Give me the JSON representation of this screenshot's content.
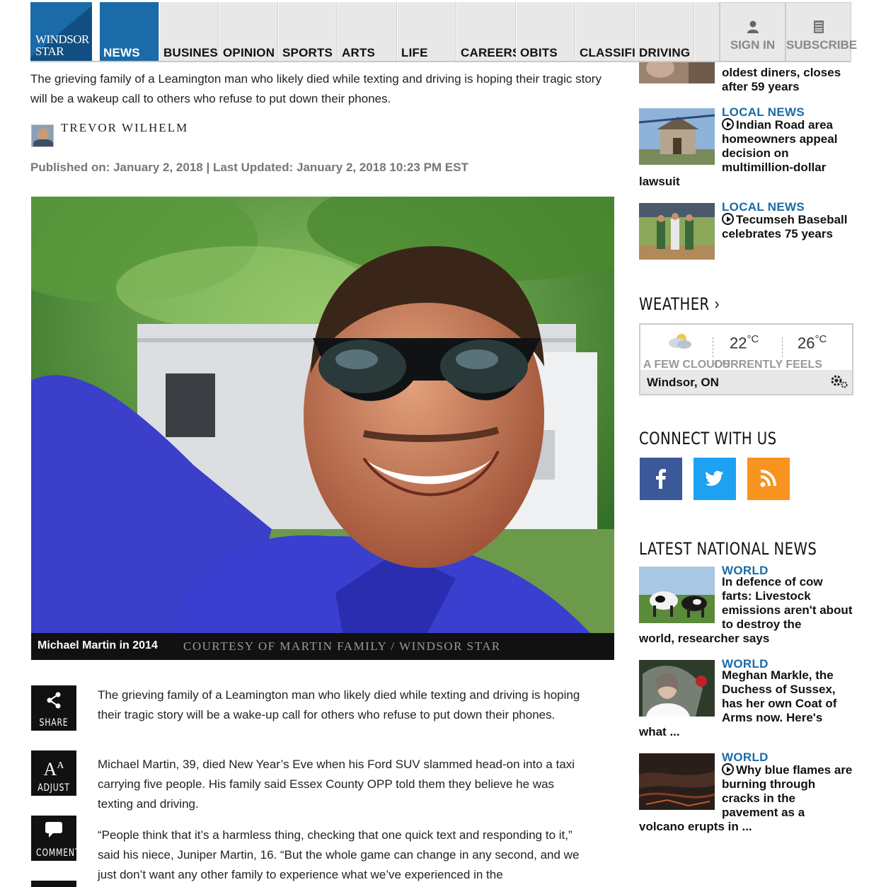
{
  "nav": {
    "logo_line1": "WINDSOR",
    "logo_line2": "STAR",
    "items": [
      "NEWS",
      "BUSINESS",
      "OPINION",
      "SPORTS",
      "ARTS",
      "LIFE",
      "CAREERS",
      "OBITS",
      "CLASSIFIEDS",
      "DRIVING"
    ],
    "active": "NEWS",
    "sign_in": "SIGN IN",
    "subscribe": "SUBSCRIBE"
  },
  "article": {
    "intro": "The grieving family of a Leamington man who likely died while texting and driving is hoping their tragic story will be a wakeup call to others who refuse to put down their phones.",
    "author": "TREVOR WILHELM",
    "published": "Published on: January 2, 2018 | Last Updated: January 2, 2018 10:23 PM EST",
    "photo_caption": "Michael Martin in 2014",
    "photo_credit": "COURTESY OF MARTIN FAMILY / WINDSOR STAR",
    "paragraphs": [
      "The grieving family of a Leamington man who likely died while texting and driving is hoping their tragic story will be a wake-up call for others who refuse to put down their phones.",
      "Michael Martin, 39, died New Year’s Eve when his Ford SUV slammed head-on into a taxi carrying five people. His family said Essex County OPP told them they believe he was texting and driving.",
      "“People think that it’s a harmless thing, checking that one quick text and responding to it,” said his niece, Juniper Martin, 16. “But the whole game can change in any second, and we just don’t want any other family to experience what we’ve experienced in the"
    ],
    "tools": {
      "share": "SHARE",
      "adjust": "ADJUST",
      "comment": "COMMENT"
    }
  },
  "sidebar": {
    "top_story_tail": "oldest diners, closes after 59 years",
    "local": [
      {
        "category": "LOCAL NEWS",
        "title_line": "Indian Road area homeowners appeal decision on multimillion-dollar",
        "title_tail": "lawsuit"
      },
      {
        "category": "LOCAL NEWS",
        "title_line": "Tecumseh Baseball celebrates 75 years",
        "title_tail": ""
      }
    ],
    "weather": {
      "heading": "WEATHER",
      "condition": "A FEW CLOUDS",
      "current_temp": "22",
      "feels_temp": "26",
      "unit": "°C",
      "feels_label": "CURRENTLY FEELS",
      "location": "Windsor, ON"
    },
    "connect_heading": "CONNECT WITH US",
    "social": [
      {
        "name": "facebook",
        "glyph": "f",
        "color": "#3b5998"
      },
      {
        "name": "twitter",
        "glyph": "🐦",
        "color": "#1da1f2"
      },
      {
        "name": "rss",
        "glyph": "◉",
        "color": "#f7931e"
      }
    ],
    "national_heading": "LATEST NATIONAL NEWS",
    "national": [
      {
        "category": "WORLD",
        "title_line": "In defence of cow farts: Livestock emissions aren't about to destroy the",
        "title_tail": "world, researcher says"
      },
      {
        "category": "WORLD",
        "title_line": "Meghan Markle, the Duchess of Sussex, has her own Coat of Arms now. Here's",
        "title_tail": "what ..."
      },
      {
        "category": "WORLD",
        "title_line": "Why blue flames are burning through cracks in the pavement as a",
        "title_tail": "volcano erupts in ..."
      }
    ]
  }
}
